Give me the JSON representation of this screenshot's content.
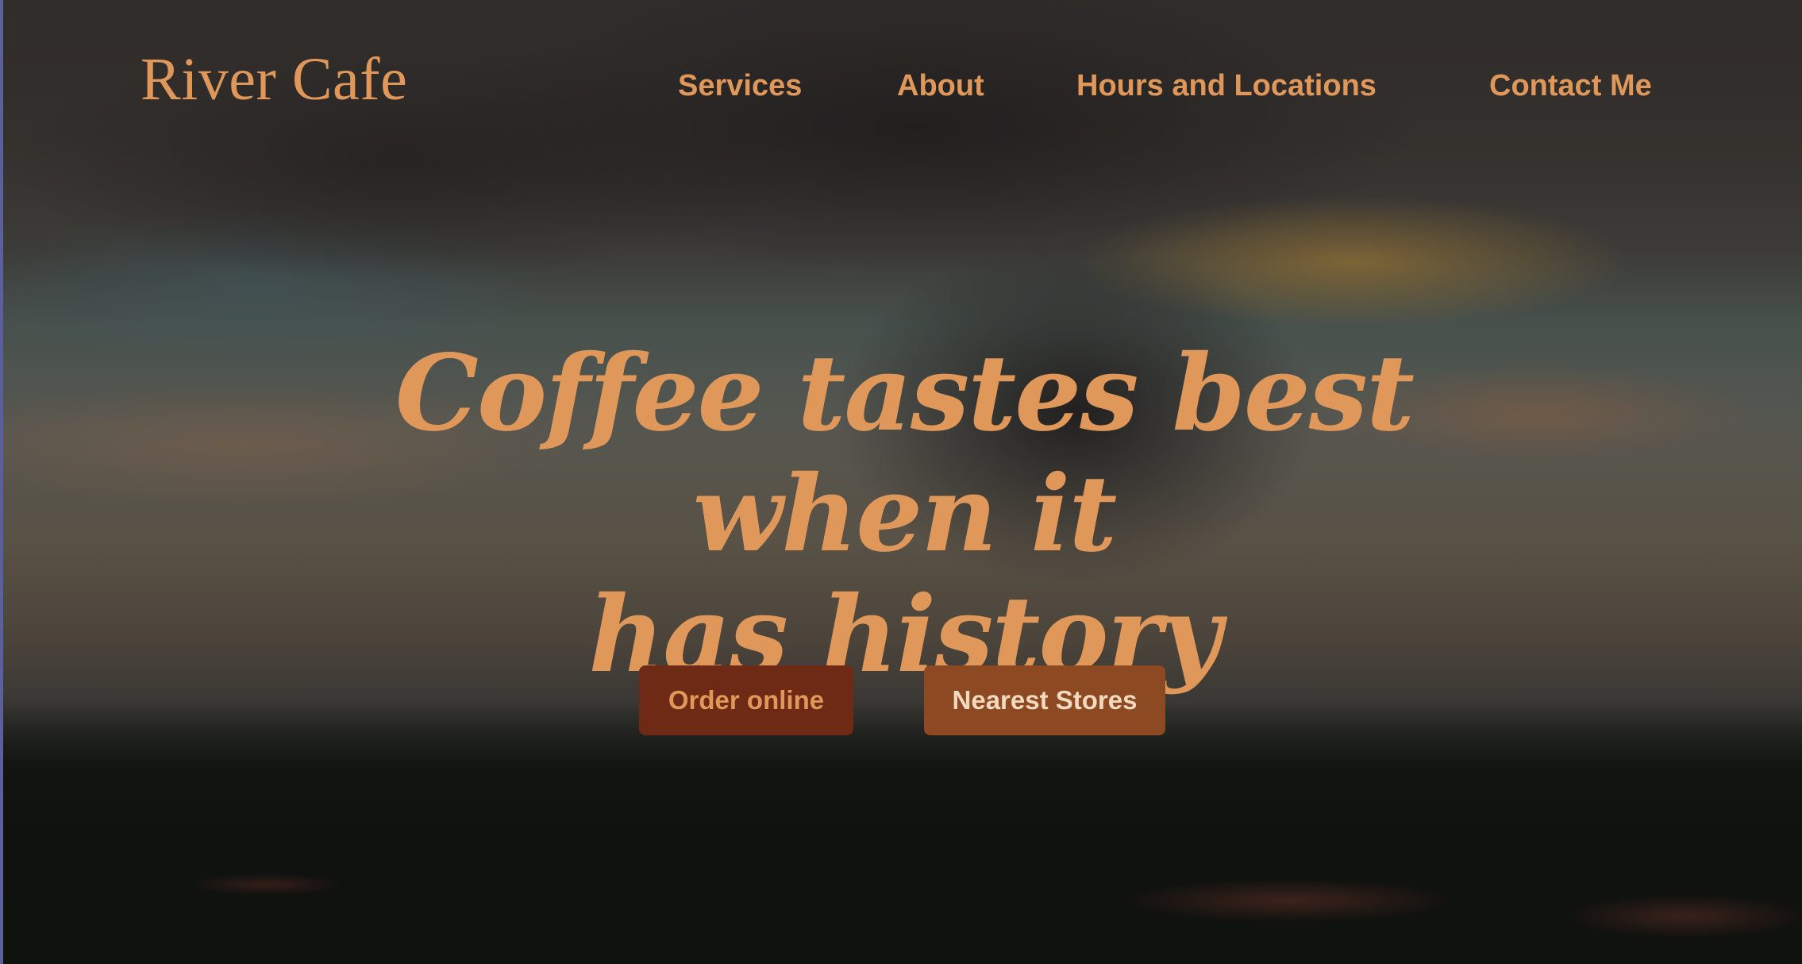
{
  "brand": {
    "name": "River Cafe"
  },
  "nav": {
    "items": [
      {
        "label": "Services"
      },
      {
        "label": "About"
      },
      {
        "label": "Hours and Locations"
      },
      {
        "label": "Contact Me"
      }
    ]
  },
  "hero": {
    "headline_line1": "Coffee tastes best when it",
    "headline_line2": "has history",
    "primary_button": "Order online",
    "secondary_button": "Nearest Stores"
  },
  "colors": {
    "accent": "#e0975a",
    "primary_button_bg": "#6e2a14",
    "secondary_button_bg": "#8d4a22",
    "secondary_button_text": "#f3d9c0"
  }
}
